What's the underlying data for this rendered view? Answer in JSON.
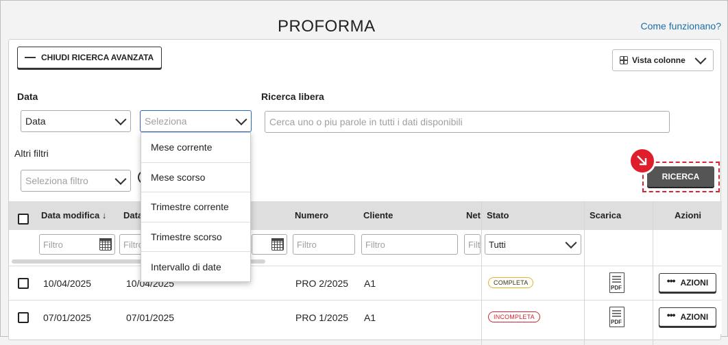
{
  "header": {
    "title": "PROFORMA",
    "help_link": "Come funzionano?"
  },
  "toolbar": {
    "close_advanced_label": "CHIUDI RICERCA AVANZATA",
    "columns_view_label": "Vista colonne"
  },
  "filters": {
    "date_label": "Data",
    "date_select_value": "Data",
    "period_select_placeholder": "Seleziona",
    "free_search_label": "Ricerca libera",
    "free_search_placeholder": "Cerca uno o piu parole in tutti i dati disponibili",
    "other_filters_label": "Altri filtri",
    "other_filters_placeholder": "Seleziona filtro",
    "search_button_label": "RICERCA"
  },
  "period_dropdown": {
    "options": [
      "Mese corrente",
      "Mese scorso",
      "Trimestre corrente",
      "Trimestre scorso",
      "Intervallo di date"
    ]
  },
  "table": {
    "headers": {
      "date_modified": "Data modifica",
      "date": "Data",
      "number": "Numero",
      "client": "Cliente",
      "net": "Net",
      "status": "Stato",
      "download": "Scarica",
      "actions": "Azioni"
    },
    "sort_indicator": "↓",
    "filter_placeholder": "Filtro",
    "filter_placeholder_short": "Filt",
    "status_filter_value": "Tutti",
    "rows": [
      {
        "date_modified": "10/04/2025",
        "date": "10/04/2025",
        "number": "PRO 2/2025",
        "client": "A1",
        "status": "COMPLETA",
        "status_type": "ok",
        "pdf": "PDF",
        "actions": "AZIONI"
      },
      {
        "date_modified": "07/01/2025",
        "date": "07/01/2025",
        "number": "PRO 1/2025",
        "client": "A1",
        "status": "INCOMPLETA",
        "status_type": "ko",
        "pdf": "PDF",
        "actions": "AZIONI"
      }
    ]
  },
  "colors": {
    "accent_red": "#e01e2b",
    "link_blue": "#1b6ea8",
    "search_button": "#555555"
  }
}
